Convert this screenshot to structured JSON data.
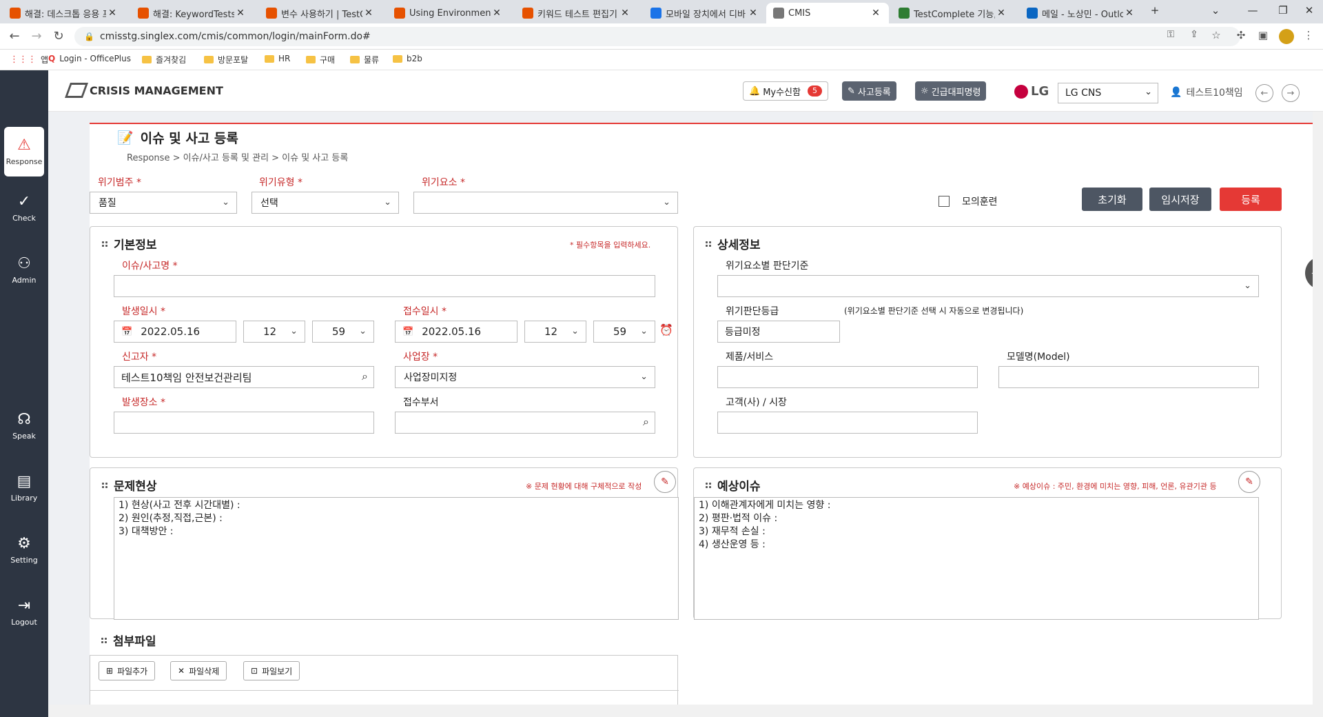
{
  "browser": {
    "tabs": [
      {
        "title": "해결: 데스크톱 응용 프",
        "color": "#e65100"
      },
      {
        "title": "해결: KeywordTests Da",
        "color": "#e65100"
      },
      {
        "title": "변수 사용하기 | TestC",
        "color": "#e65100"
      },
      {
        "title": "Using Environment Va",
        "color": "#e65100"
      },
      {
        "title": "키워드 테스트 편집기",
        "color": "#e65100"
      },
      {
        "title": "모바일 장치에서 디바",
        "color": "#1a73e8"
      },
      {
        "title": "CMIS",
        "color": "#777777"
      },
      {
        "title": "TestComplete 기능,SW",
        "color": "#2e7d32"
      },
      {
        "title": "메일 - 노상민 - Outlo",
        "color": "#0a66c2"
      }
    ],
    "new_tab": "+",
    "url": "cmisstg.singlex.com/cmis/common/login/mainForm.do#",
    "bookmarks": [
      "앱",
      "Login - OfficePlus",
      "즐겨찾김",
      "방문포탈",
      "HR",
      "구매",
      "물류",
      "b2b"
    ]
  },
  "sidebar": [
    {
      "label": "Response",
      "icon": "siren-icon"
    },
    {
      "label": "Check",
      "icon": "check-icon"
    },
    {
      "label": "Admin",
      "icon": "admin-icon"
    },
    {
      "label": "Speak",
      "icon": "speak-icon"
    },
    {
      "label": "Library",
      "icon": "library-icon"
    },
    {
      "label": "Setting",
      "icon": "gear-icon"
    },
    {
      "label": "Logout",
      "icon": "logout-icon"
    }
  ],
  "header": {
    "app_title": "CRISIS MANAGEMENT",
    "my_approval": "My수신함",
    "my_approval_count": "5",
    "incident_register": "사고등록",
    "emergency_evacuation": "긴급대피명령",
    "brand": "LG",
    "company": "LG CNS",
    "user": "테스트10책임"
  },
  "page": {
    "title": "이슈 및 사고 등록",
    "breadcrumb": "Response  >  이슈/사고 등록 및 관리  >  이슈 및 사고 등록"
  },
  "top_form": {
    "category_label": "위기범주",
    "category_value": "품질",
    "type_label": "위기유형",
    "type_value": "선택",
    "element_label": "위기요소",
    "element_value": "",
    "drill_label": "모의훈련",
    "reset": "초기화",
    "temp_save": "임시저장",
    "submit": "등록"
  },
  "basic": {
    "title": "기본정보",
    "note": "* 필수항목을 입력하세요.",
    "issue_name_label": "이슈/사고명",
    "issue_name": "",
    "occur_label": "발생일시",
    "occur_date": "2022.05.16",
    "occur_hour": "12",
    "occur_min": "59",
    "receive_label": "접수일시",
    "receive_date": "2022.05.16",
    "receive_hour": "12",
    "receive_min": "59",
    "reporter_label": "신고자",
    "reporter": "테스트10책임 안전보건관리팀",
    "site_label": "사업장",
    "site": "사업장미지정",
    "place_label": "발생장소",
    "place": "",
    "dept_label": "접수부서",
    "dept": ""
  },
  "detail": {
    "title": "상세정보",
    "criteria_label": "위기요소별 판단기준",
    "criteria": "",
    "grade_label": "위기판단등급",
    "grade_note": "(위기요소별 판단기준 선택 시 자동으로 변경됩니다)",
    "grade": "등급미정",
    "product_label": "제품/서비스",
    "product": "",
    "model_label": "모델명(Model)",
    "model": "",
    "customer_label": "고객(사) / 시장",
    "customer": ""
  },
  "problem": {
    "title": "문제현상",
    "note": "※ 문제 현황에 대해 구체적으로 작성",
    "text": "1) 현상(사고 전후 시간대별) :\n2) 원인(추정,직접,근본) :\n3) 대책방안 :"
  },
  "expected": {
    "title": "예상이슈",
    "note": "※ 예상이슈 : 주민, 환경에 미치는 영향, 피해, 언론, 유관기관 등",
    "text": "1) 이해관계자에게 미치는 영향 :\n2) 평판·법적 이슈 :\n3) 재무적 손실 :\n4) 생산운영 등 :"
  },
  "attach": {
    "title": "첨부파일",
    "add": "파일추가",
    "delete": "파일삭제",
    "view": "파일보기"
  }
}
